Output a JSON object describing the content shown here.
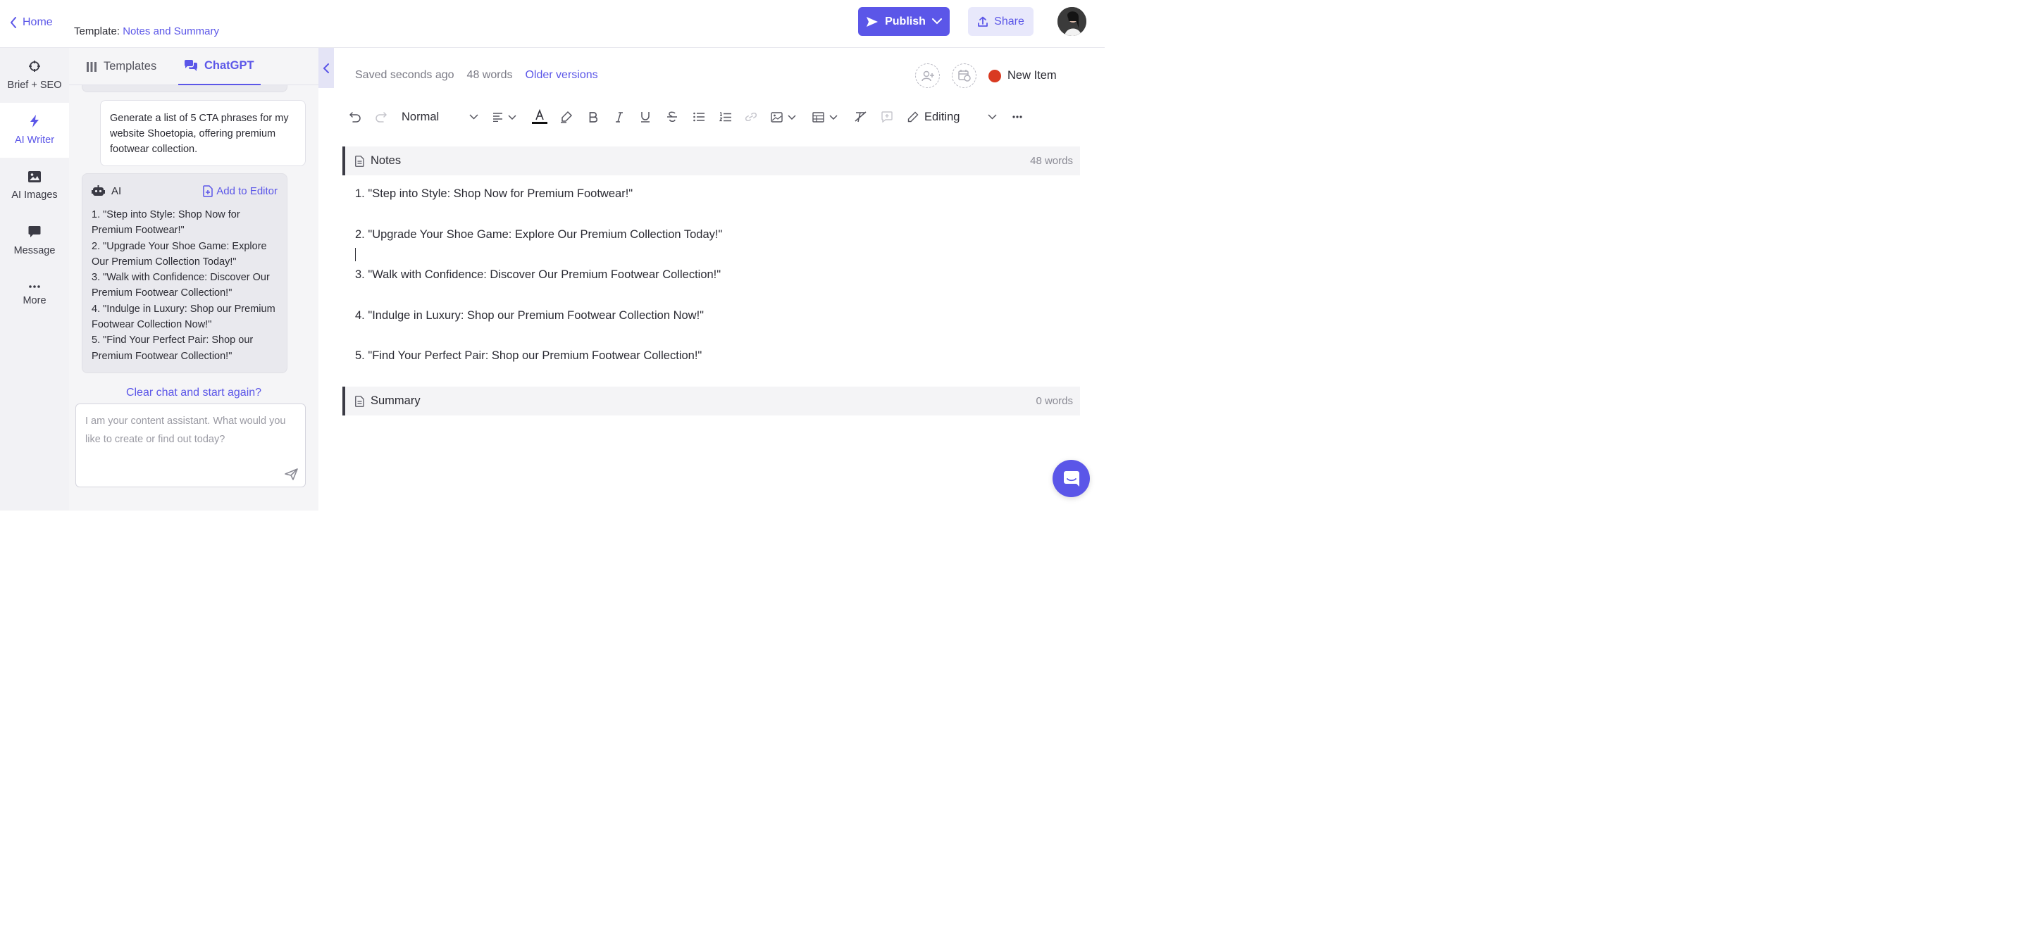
{
  "header": {
    "home_label": "Home",
    "template_prefix": "Template:",
    "template_name": "Notes and Summary",
    "publish_label": "Publish",
    "share_label": "Share"
  },
  "rail": {
    "items": [
      {
        "label": "Brief + SEO",
        "icon": "crosshair-icon"
      },
      {
        "label": "AI Writer",
        "icon": "bolt-icon",
        "active": true
      },
      {
        "label": "AI Images",
        "icon": "image-icon"
      },
      {
        "label": "Message",
        "icon": "chat-bubble-icon"
      },
      {
        "label": "More",
        "icon": "ellipsis-icon"
      }
    ]
  },
  "chat": {
    "tabs": [
      {
        "label": "Templates",
        "icon": "columns-icon"
      },
      {
        "label": "ChatGPT",
        "icon": "chat-icon",
        "active": true
      }
    ],
    "user_message": "Generate a list of 5 CTA phrases for my website Shoetopia, offering premium footwear collection.",
    "ai_label": "AI",
    "add_to_editor": "Add to Editor",
    "ai_response": [
      "1. \"Step into Style: Shop Now for Premium Footwear!\"",
      "2. \"Upgrade Your Shoe Game: Explore Our Premium Collection Today!\"",
      "3. \"Walk with Confidence: Discover Our Premium Footwear Collection!\"",
      "4. \"Indulge in Luxury: Shop our Premium Footwear Collection Now!\"",
      "5. \"Find Your Perfect Pair: Shop our Premium Footwear Collection!\""
    ],
    "clear_label": "Clear chat and start again?",
    "input_placeholder": "I am your content assistant. What would you like to create or find out today?"
  },
  "editor": {
    "saved_status": "Saved seconds ago",
    "word_count": "48 words",
    "older_versions": "Older versions",
    "status_label": "New Item",
    "status_color": "#d93a21",
    "toolbar": {
      "block_style": "Normal",
      "mode": "Editing"
    },
    "sections": [
      {
        "title": "Notes",
        "count": "48 words",
        "lines": [
          "1. \"Step into Style: Shop Now for Premium Footwear!\"",
          "2. \"Upgrade Your Shoe Game: Explore Our Premium Collection Today!\"",
          "3. \"Walk with Confidence: Discover Our Premium Footwear Collection!\"",
          "4. \"Indulge in Luxury: Shop our Premium Footwear Collection Now!\"",
          "5. \"Find Your Perfect Pair: Shop our Premium Footwear Collection!\""
        ]
      },
      {
        "title": "Summary",
        "count": "0 words",
        "lines": []
      }
    ]
  },
  "colors": {
    "accent": "#5b56e8",
    "status_red": "#d93a21"
  }
}
